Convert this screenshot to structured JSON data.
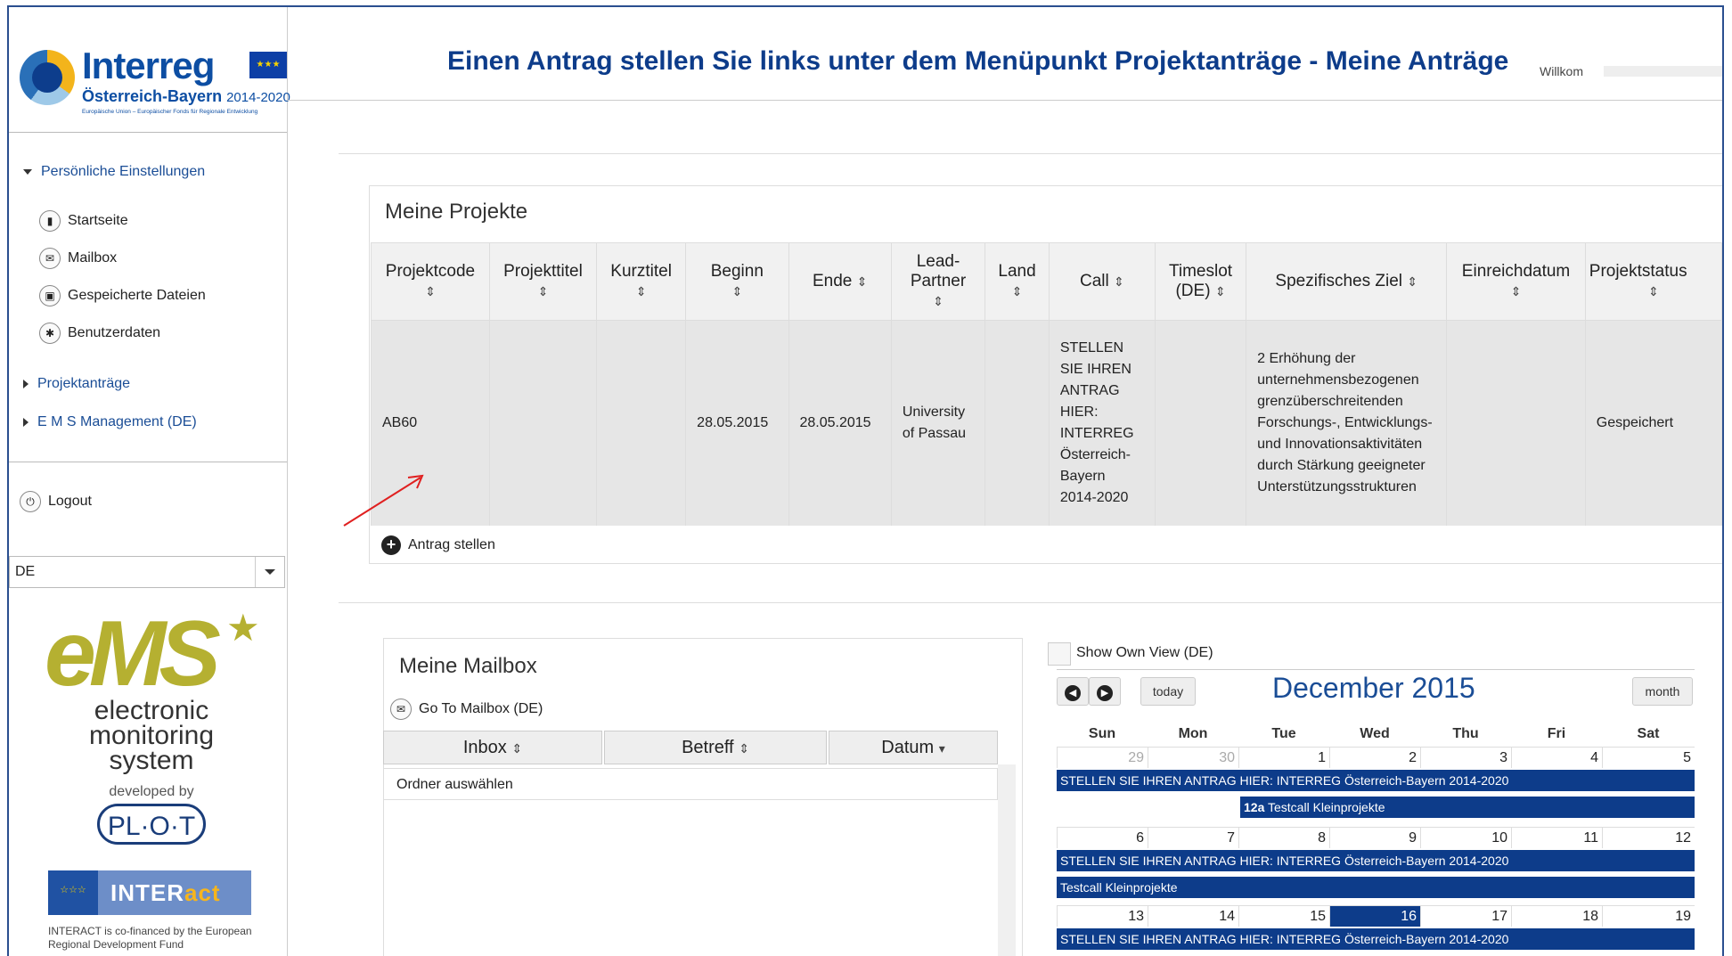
{
  "header": {
    "logo_brand": "Interreg",
    "logo_region": "Österreich-Bayern",
    "logo_years": "2014-2020",
    "logo_tagline": "Europäische Union – Europäischer Fonds für Regionale Entwicklung",
    "title": "Einen Antrag stellen Sie links unter dem Menüpunkt Projektanträge - Meine Anträge",
    "ghost_text": "Willkom"
  },
  "sidebar": {
    "section_personal": "Persönliche Einstellungen",
    "items": [
      {
        "label": "Startseite",
        "icon": "home-icon",
        "glyph": "▮"
      },
      {
        "label": "Mailbox",
        "icon": "mail-icon",
        "glyph": "✉"
      },
      {
        "label": "Gespeicherte Dateien",
        "icon": "save-icon",
        "glyph": "▣"
      },
      {
        "label": "Benutzerdaten",
        "icon": "gear-icon",
        "glyph": "✱"
      }
    ],
    "section_projects": "Projektanträge",
    "section_ems": "E M S Management (DE)",
    "logout": "Logout",
    "language": "DE"
  },
  "branding": {
    "ems_big": "eMS",
    "ems_line1": "electronic",
    "ems_line2": "monitoring",
    "ems_line3": "system",
    "developed_by": "developed by",
    "plot": "PL·O·T",
    "interact_part1": "INTER",
    "interact_part2": "act",
    "cofinanced": "INTERACT is co-financed by the European Regional Development Fund"
  },
  "projects": {
    "title": "Meine Projekte",
    "columns": [
      "Projektcode",
      "Projekttitel",
      "Kurztitel",
      "Beginn",
      "Ende",
      "Lead-Partner",
      "Land",
      "Call",
      "Timeslot (DE)",
      "Spezifisches Ziel",
      "Einreichdatum",
      "Projektstatus"
    ],
    "rows": [
      {
        "code": "AB60",
        "title": "",
        "short": "",
        "start": "28.05.2015",
        "end": "28.05.2015",
        "lead": "University of Passau",
        "country": "",
        "call": "STELLEN SIE IHREN ANTRAG HIER: INTERREG Österreich-Bayern 2014-2020",
        "timeslot": "",
        "goal": "2 Erhöhung der unternehmensbezogenen grenzüberschreitenden Forschungs-, Entwicklungs- und Innovationsaktivitäten durch Stärkung geeigneter Unterstützungsstrukturen",
        "submitted": "",
        "status": "Gespeichert"
      }
    ],
    "add_label": "Antrag stellen"
  },
  "mailbox": {
    "title": "Meine Mailbox",
    "goto": "Go To Mailbox (DE)",
    "col_inbox": "Inbox",
    "col_subject": "Betreff",
    "col_date": "Datum",
    "row_text": "Ordner auswählen"
  },
  "calendar": {
    "own_view": "Show Own View (DE)",
    "today": "today",
    "month": "month",
    "title": "December 2015",
    "weekdays": [
      "Sun",
      "Mon",
      "Tue",
      "Wed",
      "Thu",
      "Fri",
      "Sat"
    ],
    "week1": [
      "29",
      "30",
      "1",
      "2",
      "3",
      "4",
      "5"
    ],
    "week2": [
      "6",
      "7",
      "8",
      "9",
      "10",
      "11",
      "12"
    ],
    "week3": [
      "13",
      "14",
      "15",
      "16",
      "17",
      "18",
      "19"
    ],
    "event_main": "STELLEN SIE IHREN ANTRAG HIER: INTERREG Österreich-Bayern 2014-2020",
    "event_small_time": "12a",
    "event_small": "Testcall Kleinprojekte",
    "event_small_week2": "Testcall Kleinprojekte"
  }
}
